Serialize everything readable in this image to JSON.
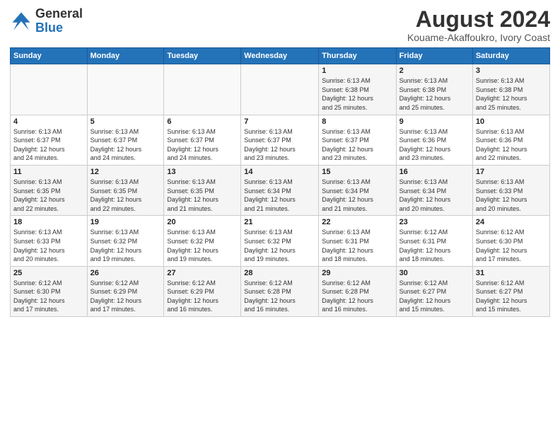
{
  "header": {
    "logo_general": "General",
    "logo_blue": "Blue",
    "title": "August 2024",
    "subtitle": "Kouame-Akaffoukro, Ivory Coast"
  },
  "calendar": {
    "days_of_week": [
      "Sunday",
      "Monday",
      "Tuesday",
      "Wednesday",
      "Thursday",
      "Friday",
      "Saturday"
    ],
    "weeks": [
      [
        {
          "day": "",
          "info": ""
        },
        {
          "day": "",
          "info": ""
        },
        {
          "day": "",
          "info": ""
        },
        {
          "day": "",
          "info": ""
        },
        {
          "day": "1",
          "info": "Sunrise: 6:13 AM\nSunset: 6:38 PM\nDaylight: 12 hours\nand 25 minutes."
        },
        {
          "day": "2",
          "info": "Sunrise: 6:13 AM\nSunset: 6:38 PM\nDaylight: 12 hours\nand 25 minutes."
        },
        {
          "day": "3",
          "info": "Sunrise: 6:13 AM\nSunset: 6:38 PM\nDaylight: 12 hours\nand 25 minutes."
        }
      ],
      [
        {
          "day": "4",
          "info": "Sunrise: 6:13 AM\nSunset: 6:37 PM\nDaylight: 12 hours\nand 24 minutes."
        },
        {
          "day": "5",
          "info": "Sunrise: 6:13 AM\nSunset: 6:37 PM\nDaylight: 12 hours\nand 24 minutes."
        },
        {
          "day": "6",
          "info": "Sunrise: 6:13 AM\nSunset: 6:37 PM\nDaylight: 12 hours\nand 24 minutes."
        },
        {
          "day": "7",
          "info": "Sunrise: 6:13 AM\nSunset: 6:37 PM\nDaylight: 12 hours\nand 23 minutes."
        },
        {
          "day": "8",
          "info": "Sunrise: 6:13 AM\nSunset: 6:37 PM\nDaylight: 12 hours\nand 23 minutes."
        },
        {
          "day": "9",
          "info": "Sunrise: 6:13 AM\nSunset: 6:36 PM\nDaylight: 12 hours\nand 23 minutes."
        },
        {
          "day": "10",
          "info": "Sunrise: 6:13 AM\nSunset: 6:36 PM\nDaylight: 12 hours\nand 22 minutes."
        }
      ],
      [
        {
          "day": "11",
          "info": "Sunrise: 6:13 AM\nSunset: 6:35 PM\nDaylight: 12 hours\nand 22 minutes."
        },
        {
          "day": "12",
          "info": "Sunrise: 6:13 AM\nSunset: 6:35 PM\nDaylight: 12 hours\nand 22 minutes."
        },
        {
          "day": "13",
          "info": "Sunrise: 6:13 AM\nSunset: 6:35 PM\nDaylight: 12 hours\nand 21 minutes."
        },
        {
          "day": "14",
          "info": "Sunrise: 6:13 AM\nSunset: 6:34 PM\nDaylight: 12 hours\nand 21 minutes."
        },
        {
          "day": "15",
          "info": "Sunrise: 6:13 AM\nSunset: 6:34 PM\nDaylight: 12 hours\nand 21 minutes."
        },
        {
          "day": "16",
          "info": "Sunrise: 6:13 AM\nSunset: 6:34 PM\nDaylight: 12 hours\nand 20 minutes."
        },
        {
          "day": "17",
          "info": "Sunrise: 6:13 AM\nSunset: 6:33 PM\nDaylight: 12 hours\nand 20 minutes."
        }
      ],
      [
        {
          "day": "18",
          "info": "Sunrise: 6:13 AM\nSunset: 6:33 PM\nDaylight: 12 hours\nand 20 minutes."
        },
        {
          "day": "19",
          "info": "Sunrise: 6:13 AM\nSunset: 6:32 PM\nDaylight: 12 hours\nand 19 minutes."
        },
        {
          "day": "20",
          "info": "Sunrise: 6:13 AM\nSunset: 6:32 PM\nDaylight: 12 hours\nand 19 minutes."
        },
        {
          "day": "21",
          "info": "Sunrise: 6:13 AM\nSunset: 6:32 PM\nDaylight: 12 hours\nand 19 minutes."
        },
        {
          "day": "22",
          "info": "Sunrise: 6:13 AM\nSunset: 6:31 PM\nDaylight: 12 hours\nand 18 minutes."
        },
        {
          "day": "23",
          "info": "Sunrise: 6:12 AM\nSunset: 6:31 PM\nDaylight: 12 hours\nand 18 minutes."
        },
        {
          "day": "24",
          "info": "Sunrise: 6:12 AM\nSunset: 6:30 PM\nDaylight: 12 hours\nand 17 minutes."
        }
      ],
      [
        {
          "day": "25",
          "info": "Sunrise: 6:12 AM\nSunset: 6:30 PM\nDaylight: 12 hours\nand 17 minutes."
        },
        {
          "day": "26",
          "info": "Sunrise: 6:12 AM\nSunset: 6:29 PM\nDaylight: 12 hours\nand 17 minutes."
        },
        {
          "day": "27",
          "info": "Sunrise: 6:12 AM\nSunset: 6:29 PM\nDaylight: 12 hours\nand 16 minutes."
        },
        {
          "day": "28",
          "info": "Sunrise: 6:12 AM\nSunset: 6:28 PM\nDaylight: 12 hours\nand 16 minutes."
        },
        {
          "day": "29",
          "info": "Sunrise: 6:12 AM\nSunset: 6:28 PM\nDaylight: 12 hours\nand 16 minutes."
        },
        {
          "day": "30",
          "info": "Sunrise: 6:12 AM\nSunset: 6:27 PM\nDaylight: 12 hours\nand 15 minutes."
        },
        {
          "day": "31",
          "info": "Sunrise: 6:12 AM\nSunset: 6:27 PM\nDaylight: 12 hours\nand 15 minutes."
        }
      ]
    ]
  }
}
